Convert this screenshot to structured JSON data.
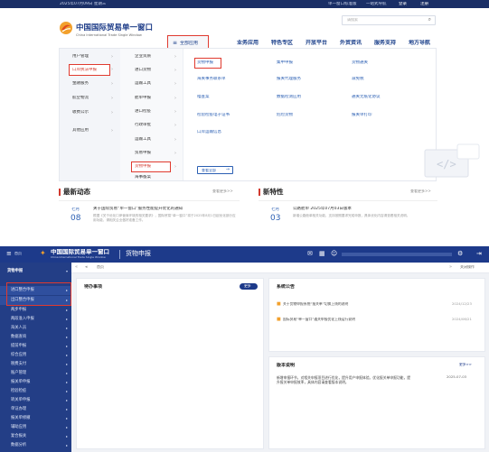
{
  "top": {
    "topbar": {
      "date": "2025年07月09日 星期三",
      "links": [
        "单一窗口标准版",
        "一站式导航",
        "登录",
        "注册"
      ]
    },
    "logo": {
      "title": "中国国际贸易单一窗口",
      "subtitle": "China International Trade Single Window"
    },
    "all_apps_button": "全部应用",
    "search_placeholder": "请搜索",
    "nav": [
      "业务应用",
      "特色专区",
      "开放平台",
      "外贸资讯",
      "服务支持",
      "地方导航"
    ],
    "menu": {
      "col1": [
        "用户管理",
        "口岸执法申报",
        "金融服务",
        "航空物流",
        "收费公示",
        "其他应用"
      ],
      "col2": [
        "企业资质",
        "进口货物",
        "运输工具",
        "舱单申报",
        "进口检疫",
        "行政审批",
        "运输工具",
        "贸易申报",
        "货物申报",
        "海事备案"
      ],
      "col3": [
        "货物申报",
        "海关事务联系单",
        "稽查案",
        "检验检疫电子证书",
        "口岸运输信息"
      ],
      "col4": [
        "集中申报",
        "报关代理服务",
        "数据检测应用",
        "危险货物"
      ],
      "col5": [
        "货物通关",
        "减免税",
        "通关无纸化协议",
        "报关单打印"
      ],
      "view_all": "查看全部"
    },
    "news": {
      "title": "最新动态",
      "more": "查看更多>>",
      "date_day": "08",
      "date_month": "七月",
      "headline": "关于国际贸易“单一窗口”服务性能提升优化的通知",
      "body": "根据《关于优化口岸营商环境的相关要求》，国际贸易“单一窗口”将于2025年8月1日起优化部分应用功能，请相关企业做好准备工作。"
    },
    "features": {
      "title": "新特性",
      "more": "查看更多>>",
      "date_day": "03",
      "date_month": "七月",
      "headline": "公路舱单 2025年07月03日版本",
      "body": "新增公路舱单相关功能，支持按照要求完成申报，具体优化内容请查看相关说明。"
    }
  },
  "bottom": {
    "header": {
      "logo_title": "中国国际贸易单一窗口",
      "logo_subtitle": "China International Trade Single Window",
      "page_title": "货物申报",
      "home_label": "首页"
    },
    "sidebar": {
      "title": "货物申报",
      "items": [
        "进口整合申报",
        "出口整合申报",
        "两步申报",
        "两段准入申报",
        "海关人员",
        "数据查询",
        "提前申报",
        "综合应用",
        "税费支付",
        "账户管理",
        "报关单申报",
        "检验检疫",
        "转关单申报",
        "单证办理",
        "报关单修撤",
        "辅助应用",
        "复合报关",
        "数据分析",
        "其他申报"
      ]
    },
    "tabbar": {
      "tab": "首页",
      "right_label": "关闭操作"
    },
    "todo": {
      "title": "待办事项",
      "badge": "更多"
    },
    "notice": {
      "title": "系统公告",
      "rows": [
        {
          "text": "关于货物申报系统“报关单”切换上线的说明",
          "date": "2024/12/23"
        },
        {
          "text": "国际贸易“单一窗口”通关申报优化上线运行说明",
          "date": "2024/06/21"
        }
      ]
    },
    "release": {
      "title": "版本说明",
      "more": "更多>>",
      "date": "2025-07-03",
      "body": "新增申报环节，对相关申报项目进行优化，提升用户申报体验。优化报关单申报功能，提升报关单申报效率，具体内容请查看版本说明。"
    }
  }
}
